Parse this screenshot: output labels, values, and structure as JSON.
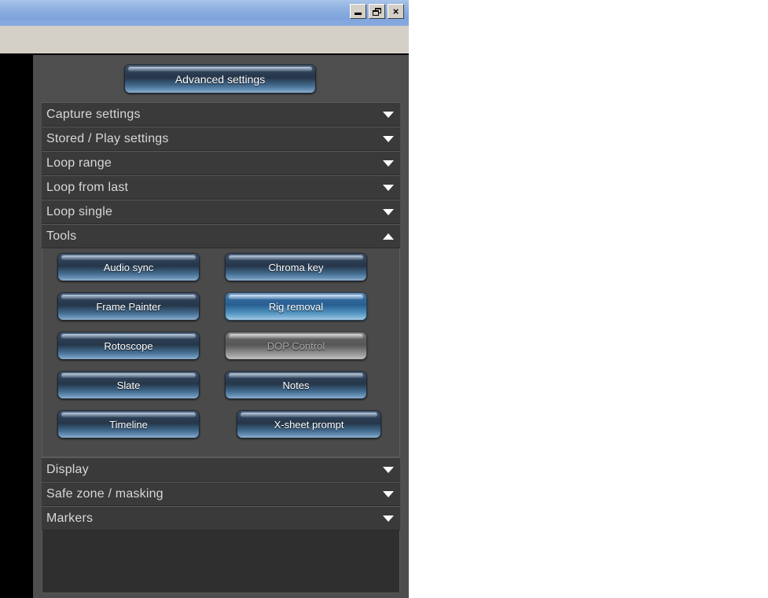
{
  "window": {
    "controls": [
      {
        "name": "minimize",
        "glyph": "minimize-icon",
        "title": "Minimize"
      },
      {
        "name": "restore",
        "glyph": "restore-icon",
        "title": "Restore"
      },
      {
        "name": "close",
        "glyph": "close-icon",
        "label": "×",
        "title": "Close"
      }
    ]
  },
  "panel": {
    "advanced_settings_label": "Advanced settings",
    "sections": [
      {
        "id": "capture-settings",
        "label": "Capture settings",
        "expanded": false,
        "chevron": "chevron-down-icon"
      },
      {
        "id": "stored-play",
        "label": "Stored / Play settings",
        "expanded": false,
        "chevron": "chevron-down-icon"
      },
      {
        "id": "loop-range",
        "label": "Loop range",
        "expanded": false,
        "chevron": "chevron-down-icon"
      },
      {
        "id": "loop-from-last",
        "label": "Loop from last",
        "expanded": false,
        "chevron": "chevron-down-icon"
      },
      {
        "id": "loop-single",
        "label": "Loop single",
        "expanded": false,
        "chevron": "chevron-down-icon"
      },
      {
        "id": "tools",
        "label": "Tools",
        "expanded": true,
        "chevron": "chevron-up-icon"
      },
      {
        "id": "display",
        "label": "Display",
        "expanded": false,
        "chevron": "chevron-down-icon"
      },
      {
        "id": "safe-zone-masking",
        "label": "Safe zone / masking",
        "expanded": false,
        "chevron": "chevron-down-icon"
      },
      {
        "id": "markers",
        "label": "Markers",
        "expanded": false,
        "chevron": "chevron-down-icon"
      }
    ],
    "tools": [
      {
        "id": "audio-sync",
        "label": "Audio sync",
        "column": "left",
        "row": 0,
        "state": "normal"
      },
      {
        "id": "chroma-key",
        "label": "Chroma key",
        "column": "right",
        "row": 0,
        "state": "normal"
      },
      {
        "id": "frame-painter",
        "label": "Frame Painter",
        "column": "left",
        "row": 1,
        "state": "normal"
      },
      {
        "id": "rig-removal",
        "label": "Rig removal",
        "column": "right",
        "row": 1,
        "state": "highlighted"
      },
      {
        "id": "rotoscope",
        "label": "Rotoscope",
        "column": "left",
        "row": 2,
        "state": "normal"
      },
      {
        "id": "dop-control",
        "label": "DOP Control",
        "column": "right",
        "row": 2,
        "state": "disabled"
      },
      {
        "id": "slate",
        "label": "Slate",
        "column": "left",
        "row": 3,
        "state": "normal"
      },
      {
        "id": "notes",
        "label": "Notes",
        "column": "right",
        "row": 3,
        "state": "normal"
      },
      {
        "id": "timeline",
        "label": "Timeline",
        "column": "left",
        "row": 4,
        "state": "normal"
      },
      {
        "id": "x-sheet-prompt",
        "label": "X-sheet prompt",
        "column": "right",
        "row": 4,
        "state": "normal"
      }
    ]
  },
  "colors": {
    "titlebar_blue": "#8fb0e0",
    "toolbar_beige": "#d4d0c8",
    "panel_grey": "#4e4e4e",
    "section_header_grey": "#3a3a3a",
    "button_blue": "#2b3e53",
    "button_highlight_blue": "#2f6699",
    "button_disabled_grey": "#5e5e5e",
    "text_light": "#d8d8d8",
    "workspace_black": "#000000"
  }
}
